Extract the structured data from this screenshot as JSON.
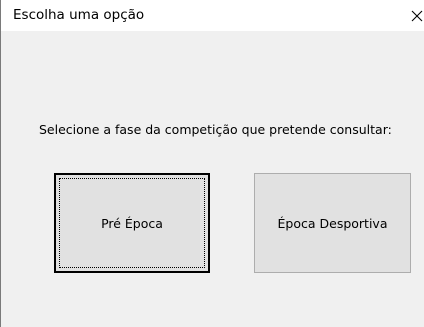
{
  "dialog": {
    "title": "Escolha uma opção",
    "close_glyph": "✕",
    "prompt": "Selecione a fase da competição que pretende consultar:",
    "buttons": {
      "pre_epoca": "Pré Época",
      "epoca_desportiva": "Época Desportiva"
    }
  },
  "colors": {
    "titlebar": "#ffffff",
    "body": "#f0f0f0",
    "button_face": "#e1e1e1",
    "button_border": "#adadad",
    "focused_border": "#000000"
  },
  "icons": {
    "close": "close-icon"
  }
}
